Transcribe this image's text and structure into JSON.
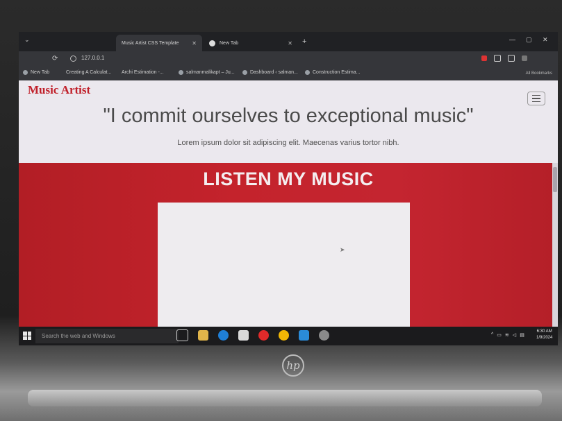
{
  "browser": {
    "tabs": [
      {
        "label": "Music Artist CSS Template",
        "active": true
      },
      {
        "label": "New Tab",
        "active": false
      }
    ],
    "address": "127.0.0.1",
    "bookmarks": [
      "New Tab",
      "Creating A Calculat...",
      "Archi Estimation -...",
      "salmanmalikapt – Ju...",
      "Dashboard ‹ salman...",
      "Construction Estima..."
    ],
    "all_bookmarks": "All Bookmarks"
  },
  "page": {
    "brand": "Music Artist",
    "quote": "\"I commit ourselves to exceptional music\"",
    "lead": "Lorem ipsum dolor sit adipiscing elit. Maecenas varius tortor nibh.",
    "section_title": "LISTEN MY MUSIC"
  },
  "taskbar": {
    "search_placeholder": "Search the web and Windows",
    "time": "6:30 AM",
    "date": "1/9/2024"
  },
  "device": {
    "logo": "hp"
  },
  "colors": {
    "brand_red": "#c0202a",
    "section_red": "#c4232c",
    "page_bg": "#ebe8ee"
  }
}
